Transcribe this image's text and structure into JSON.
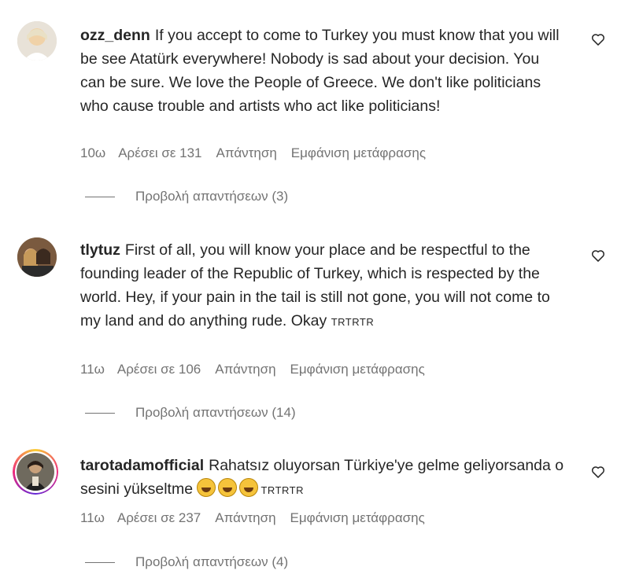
{
  "comments": [
    {
      "username": "ozz_denn",
      "text": "If you accept to come to Turkey you must know that you will be see Atatürk everywhere! Nobody is sad about your decision. You can be sure. We love the People of Greece. We don't like politicians who cause trouble and artists who act like politicians!",
      "age": "10ω",
      "likes": "Αρέσει σε 131",
      "reply": "Απάντηση",
      "translate": "Εμφάνιση μετάφρασης",
      "view_replies": "Προβολή απαντήσεων (3)",
      "avatar_icon": "user-photo",
      "like_icon": "heart-outline-icon"
    },
    {
      "username": "tlytuz",
      "text": "First of all, you will know your place and be respectful to the founding leader of the Republic of Turkey, which is respected by the world. Hey, if your pain in the tail is still not gone, you will not come to my land and do anything rude. Okay",
      "text_suffix": "TRTRTR",
      "age": "11ω",
      "likes": "Αρέσει σε 106",
      "reply": "Απάντηση",
      "translate": "Εμφάνιση μετάφρασης",
      "view_replies": "Προβολή απαντήσεων (14)",
      "avatar_icon": "user-photo",
      "like_icon": "heart-outline-icon"
    },
    {
      "username": "tarotadamofficial",
      "text": "Rahatsız oluyorsan Türkiye'ye gelme geliyorsanda o sesini yükseltme",
      "text_suffix": "TRTRTR",
      "emojis": [
        "laughing-tears-emoji",
        "sweat-smile-emoji",
        "rofl-emoji"
      ],
      "age": "11ω",
      "likes": "Αρέσει σε 237",
      "reply": "Απάντηση",
      "translate": "Εμφάνιση μετάφρασης",
      "view_replies": "Προβολή απαντήσεων (4)",
      "avatar_icon": "user-photo-story-ring",
      "like_icon": "heart-outline-icon"
    }
  ]
}
